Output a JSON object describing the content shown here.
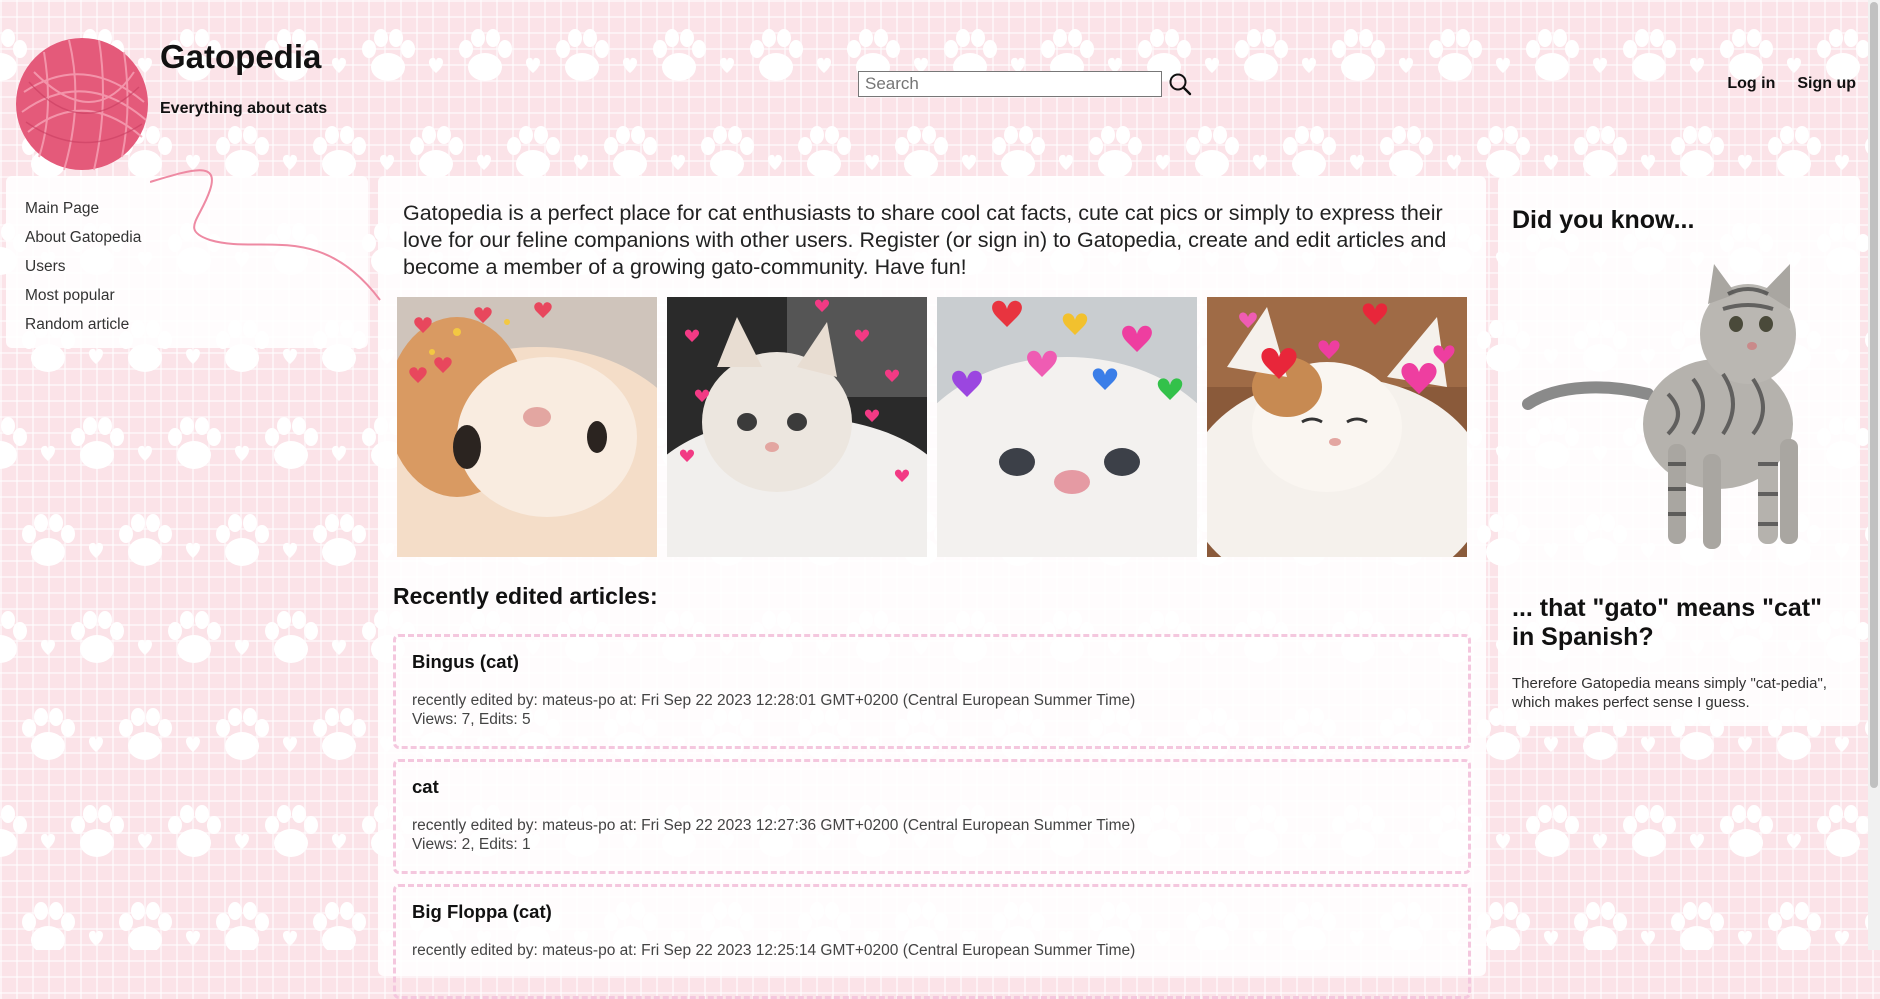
{
  "header": {
    "site_title": "Gatopedia",
    "tagline": "Everything about cats",
    "search_placeholder": "Search",
    "login_label": "Log in",
    "signup_label": "Sign up"
  },
  "sidebar": {
    "items": [
      {
        "label": "Main Page"
      },
      {
        "label": "About Gatopedia"
      },
      {
        "label": "Users"
      },
      {
        "label": "Most popular"
      },
      {
        "label": "Random article"
      }
    ]
  },
  "main": {
    "intro": "Gatopedia is a perfect place for cat enthusiasts to share cool cat facts, cute cat pics or simply to express their love for our feline companions with other users. Register (or sign in) to Gatopedia, create and edit articles and become a member of a growing gato-community. Have fun!",
    "recent_title": "Recently edited articles:",
    "articles": [
      {
        "title": "Bingus (cat)",
        "edited": "recently edited by: mateus-po at: Fri Sep 22 2023 12:28:01 GMT+0200 (Central European Summer Time)",
        "stats": "Views: 7, Edits: 5"
      },
      {
        "title": "cat",
        "edited": "recently edited by: mateus-po at: Fri Sep 22 2023 12:27:36 GMT+0200 (Central European Summer Time)",
        "stats": "Views: 2, Edits: 1"
      },
      {
        "title": "Big Floppa (cat)",
        "edited": "recently edited by: mateus-po at: Fri Sep 22 2023 12:25:14 GMT+0200 (Central European Summer Time)",
        "stats": ""
      }
    ]
  },
  "right": {
    "heading": "Did you know...",
    "fact": "... that \"gato\" means \"cat\" in Spanish?",
    "fact_detail": "Therefore Gatopedia means simply \"cat-pedia\", which makes perfect sense I guess."
  },
  "colors": {
    "background": "#fbe3e8",
    "paw": "#ffffff",
    "yarn": "#e45a7a",
    "card_border": "#f4c7de"
  }
}
